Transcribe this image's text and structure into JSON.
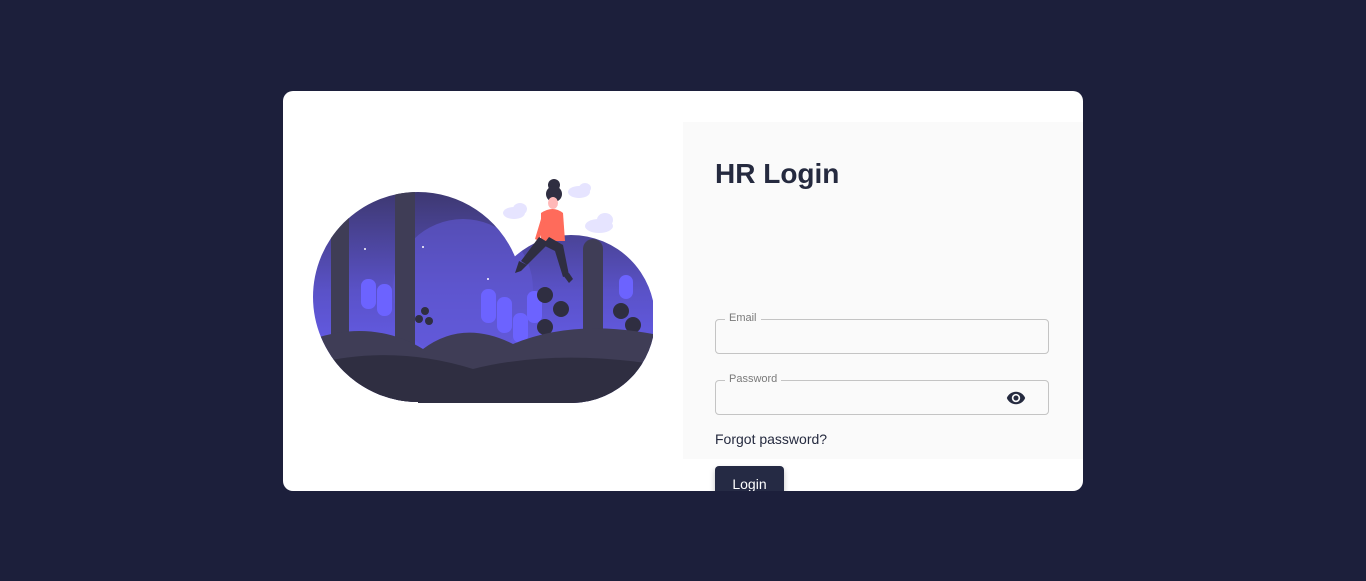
{
  "page": {
    "background_color": "#1c1f3b"
  },
  "illustration": {
    "icon": "forest-night-illustration",
    "accent_color": "#6c63ff"
  },
  "login": {
    "title": "HR Login",
    "email": {
      "label": "Email",
      "value": ""
    },
    "password": {
      "label": "Password",
      "value": "",
      "toggle_icon": "eye-icon"
    },
    "forgot_password": "Forgot password?",
    "submit_label": "Login",
    "button_color": "#252a44"
  }
}
